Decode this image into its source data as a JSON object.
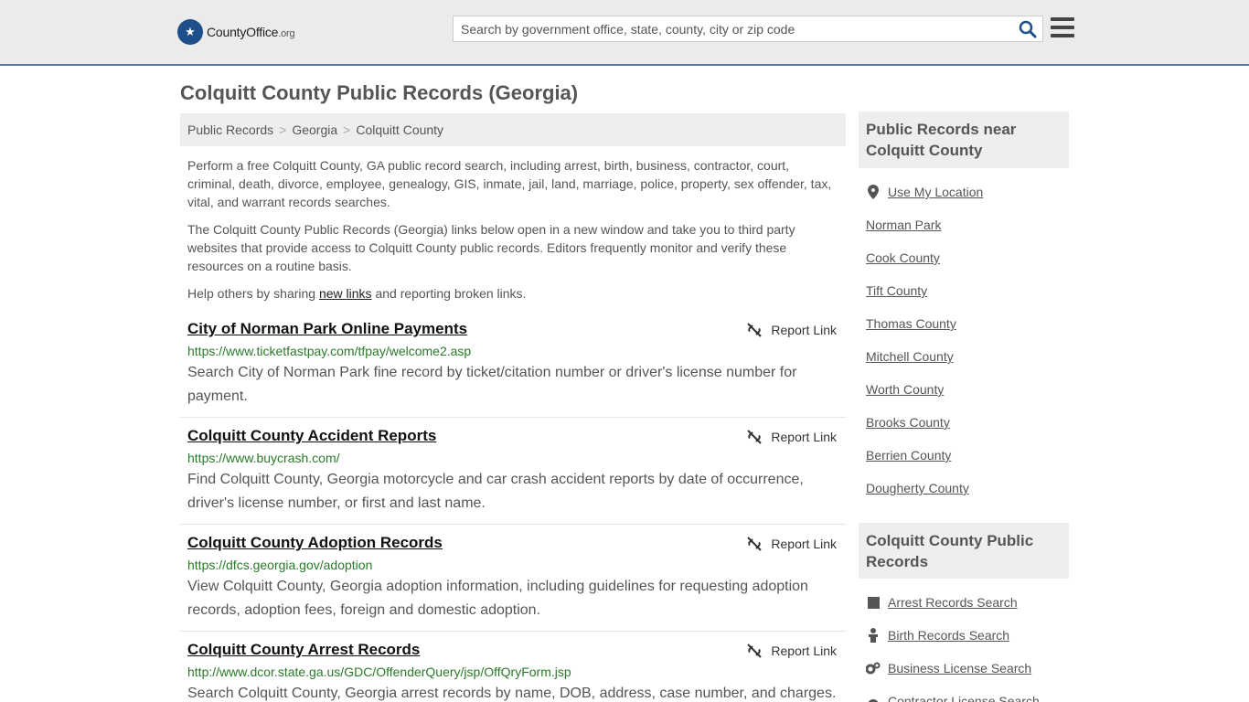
{
  "header": {
    "logo_text": "CountyOffice",
    "logo_tld": ".org",
    "search_placeholder": "Search by government office, state, county, city or zip code"
  },
  "page_title": "Colquitt County Public Records (Georgia)",
  "breadcrumb": [
    "Public Records",
    "Georgia",
    "Colquitt County"
  ],
  "intro": {
    "p1": "Perform a free Colquitt County, GA public record search, including arrest, birth, business, contractor, court, criminal, death, divorce, employee, genealogy, GIS, inmate, jail, land, marriage, police, property, sex offender, tax, vital, and warrant records searches.",
    "p2": "The Colquitt County Public Records (Georgia) links below open in a new window and take you to third party websites that provide access to Colquitt County public records. Editors frequently monitor and verify these resources on a routine basis.",
    "p3_before": "Help others by sharing ",
    "p3_link": "new links",
    "p3_after": " and reporting broken links."
  },
  "report_label": "Report Link",
  "listings": [
    {
      "title": "City of Norman Park Online Payments",
      "url": "https://www.ticketfastpay.com/tfpay/welcome2.asp",
      "desc": "Search City of Norman Park fine record by ticket/citation number or driver's license number for payment."
    },
    {
      "title": "Colquitt County Accident Reports",
      "url": "https://www.buycrash.com/",
      "desc": "Find Colquitt County, Georgia motorcycle and car crash accident reports by date of occurrence, driver's license number, or first and last name."
    },
    {
      "title": "Colquitt County Adoption Records",
      "url": "https://dfcs.georgia.gov/adoption",
      "desc": "View Colquitt County, Georgia adoption information, including guidelines for requesting adoption records, adoption fees, foreign and domestic adoption."
    },
    {
      "title": "Colquitt County Arrest Records",
      "url": "http://www.dcor.state.ga.us/GDC/OffenderQuery/jsp/OffQryForm.jsp",
      "desc": "Search Colquitt County, Georgia arrest records by name, DOB, address, case number, and charges."
    }
  ],
  "sidebar": {
    "near_title": "Public Records near Colquitt County",
    "use_location": "Use My Location",
    "near": [
      "Norman Park",
      "Cook County",
      "Tift County",
      "Thomas County",
      "Mitchell County",
      "Worth County",
      "Brooks County",
      "Berrien County",
      "Dougherty County"
    ],
    "records_title": "Colquitt County Public Records",
    "records": [
      "Arrest Records Search",
      "Birth Records Search",
      "Business License Search",
      "Contractor License Search"
    ]
  }
}
